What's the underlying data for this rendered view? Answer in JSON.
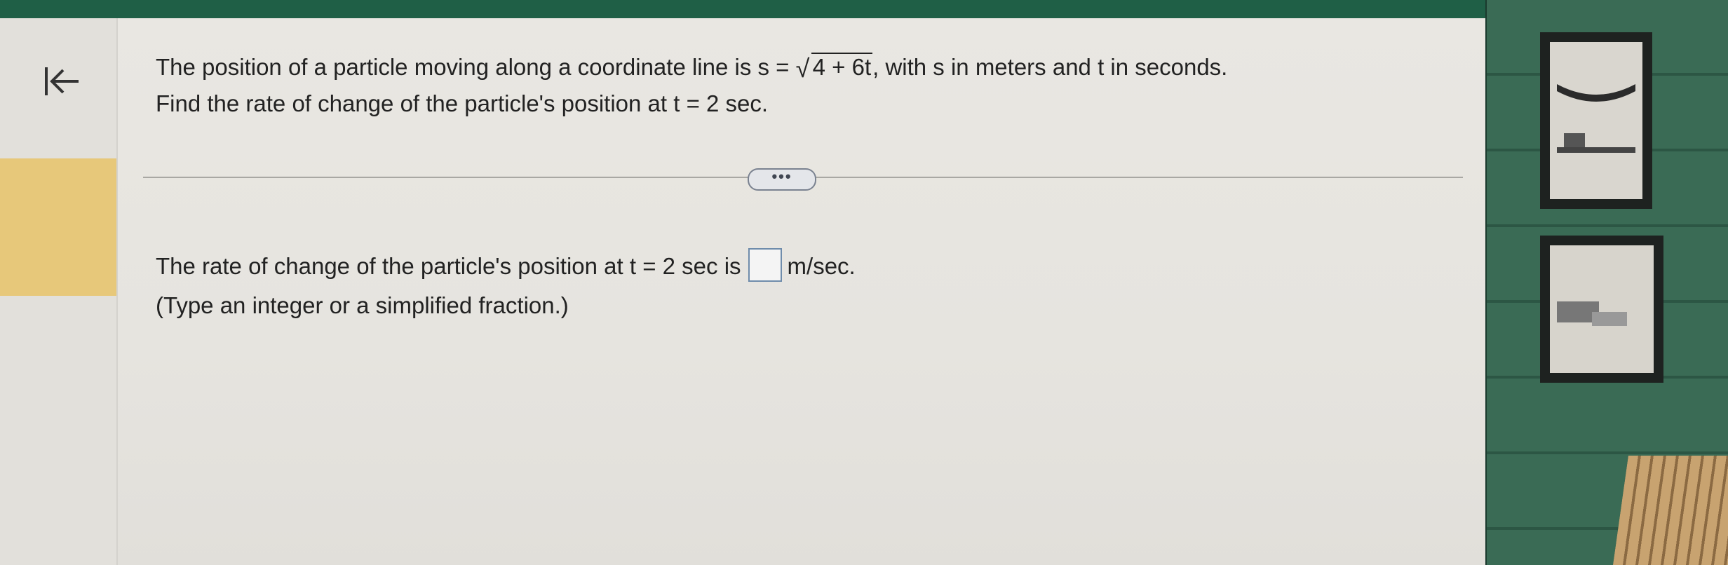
{
  "question": {
    "line1_prefix": "The position of a particle moving along a coordinate line is s =",
    "sqrt_radicand": "4 + 6t",
    "line1_suffix": ", with s in meters and t in seconds.",
    "line2": "Find the rate of change of the particle's position at t = 2 sec."
  },
  "answer": {
    "prefix": "The rate of change of the particle's position at t = 2 sec is",
    "value": "",
    "unit": "m/sec.",
    "hint": "(Type an integer or a simplified fraction.)"
  },
  "more_label": "•••",
  "colors": {
    "nav_highlight": "#e7c87a",
    "answer_box_border": "#6f8cab",
    "top_bar": "#1f5f46"
  },
  "icons": {
    "back": "arrow-left-bar-icon",
    "more": "more-dots-icon"
  }
}
